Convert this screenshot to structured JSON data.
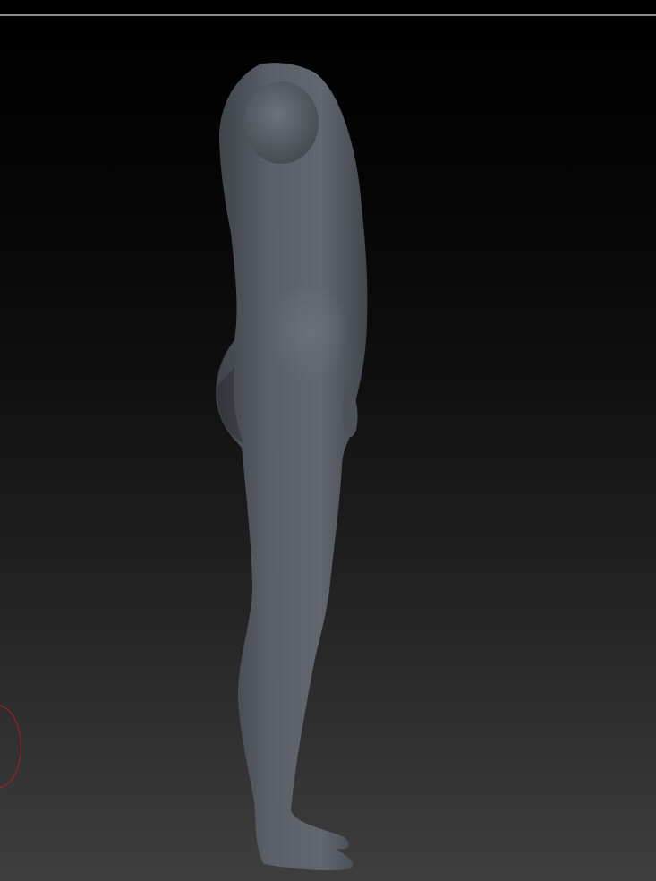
{
  "app": {
    "viewport_label": "",
    "brush_color": "#b01e1e",
    "background_top": "#000000",
    "background_bottom": "#3e3e3e",
    "model_color": "#555a63"
  },
  "scene": {
    "subject": "mannequin-sculpt",
    "view": "side"
  }
}
